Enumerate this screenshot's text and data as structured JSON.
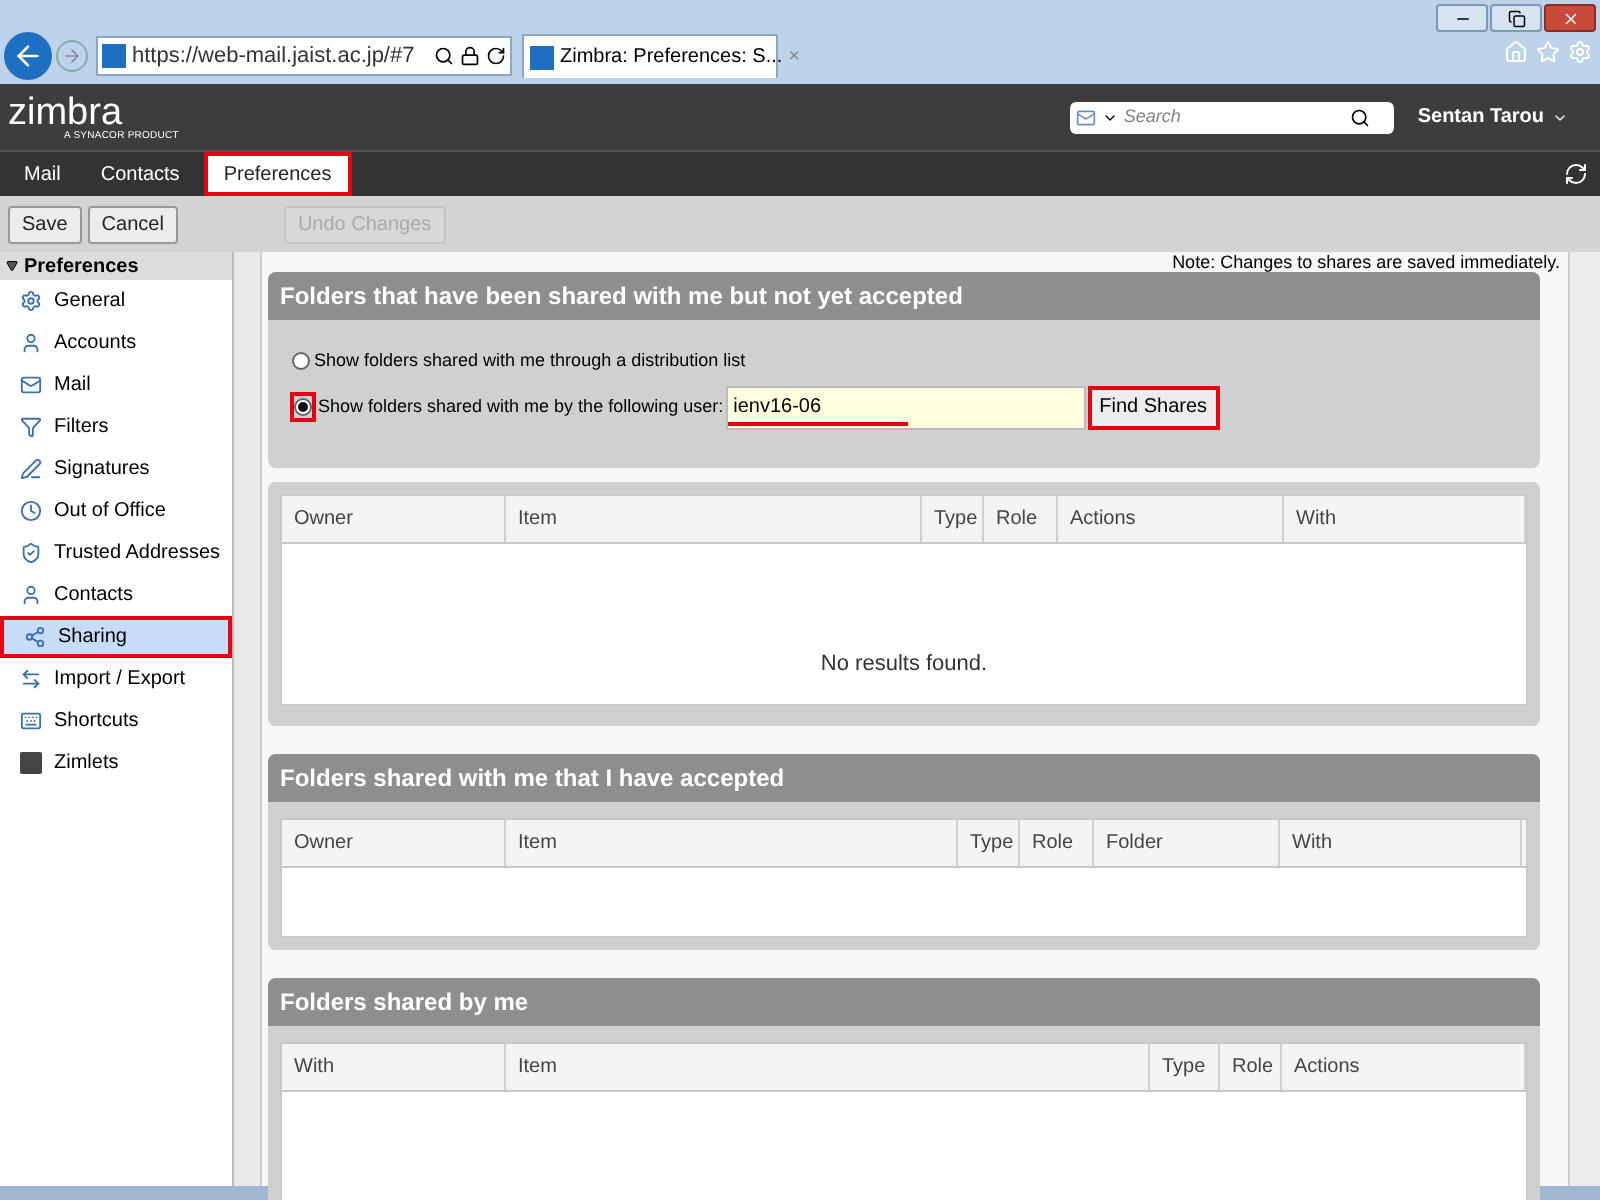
{
  "browser": {
    "url": "https://web-mail.jaist.ac.jp/#7",
    "tab_title": "Zimbra: Preferences: S...",
    "tab_close": "×"
  },
  "header": {
    "logo": "zimbra",
    "logo_sub": "A SYNACOR PRODUCT",
    "search_placeholder": "Search",
    "user": "Sentan Tarou"
  },
  "nav": [
    {
      "label": "Mail",
      "selected": false,
      "highlighted": false
    },
    {
      "label": "Contacts",
      "selected": false,
      "highlighted": false
    },
    {
      "label": "Preferences",
      "selected": true,
      "highlighted": true
    }
  ],
  "toolbar": [
    {
      "label": "Save",
      "disabled": false
    },
    {
      "label": "Cancel",
      "disabled": false
    },
    {
      "label": "Undo Changes",
      "disabled": true
    }
  ],
  "sidebar": {
    "title": "Preferences",
    "expanded": true,
    "items": [
      {
        "label": "General",
        "selected": false
      },
      {
        "label": "Accounts",
        "selected": false
      },
      {
        "label": "Mail",
        "selected": false
      },
      {
        "label": "Filters",
        "selected": false
      },
      {
        "label": "Signatures",
        "selected": false
      },
      {
        "label": "Out of Office",
        "selected": false
      },
      {
        "label": "Trusted Addresses",
        "selected": false
      },
      {
        "label": "Contacts",
        "selected": false
      },
      {
        "label": "Sharing",
        "selected": true
      },
      {
        "label": "Import / Export",
        "selected": false
      },
      {
        "label": "Shortcuts",
        "selected": false
      },
      {
        "label": "Zimlets",
        "selected": false
      }
    ]
  },
  "note": "Note: Changes to shares are saved immediately.",
  "pending": {
    "title": "Folders that have been shared with me but not yet accepted",
    "options": [
      {
        "label": "Show folders shared with me through a distribution list",
        "selected": false,
        "highlighted": false
      },
      {
        "label": "Show folders shared with me by the following user:",
        "selected": true,
        "highlighted": true
      }
    ],
    "user_value": "ienv16-06",
    "find_button": "Find Shares",
    "columns": [
      "Owner",
      "Item",
      "Type",
      "Role",
      "Actions",
      "With"
    ],
    "empty_text": "No results found."
  },
  "accepted": {
    "title": "Folders shared with me that I have accepted",
    "columns": [
      "Owner",
      "Item",
      "Type",
      "Role",
      "Folder",
      "With"
    ]
  },
  "shared_by_me": {
    "title": "Folders shared by me",
    "columns": [
      "With",
      "Item",
      "Type",
      "Role",
      "Actions"
    ]
  }
}
